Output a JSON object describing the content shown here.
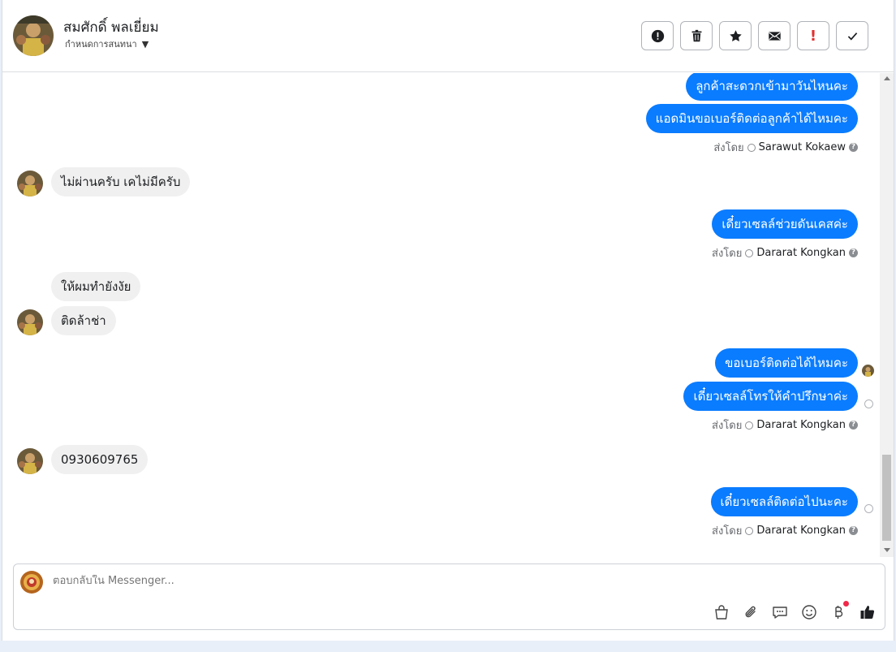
{
  "header": {
    "name": "สมศักดิ์ พลเยี่ยม",
    "subtitle": "กำหนดการสนทนา",
    "actions": [
      "important-icon",
      "trash-icon",
      "star-icon",
      "mail-icon",
      "exclamation-icon",
      "check-icon"
    ],
    "exclamation_glyph": "!"
  },
  "messages": {
    "m1": "ลูกค้าสะดวกเข้ามาวันไหนคะ",
    "m2": "แอดมินขอเบอร์ติดต่อลูกค้าได้ไหมคะ",
    "sent_label": "ส่งโดย",
    "sent1_who": "Sarawut Kokaew",
    "in1": "ไม่ผ่านครับ เคไม่มีครับ",
    "m3": "เดี๋ยวเซลล์ช่วยดันเคสค่ะ",
    "sent2_who": "Dararat Kongkan",
    "in2": "ให้ผมทำยังงัย",
    "in3": "ติดล้าช่า",
    "m4": "ขอเบอร์ติดต่อได้ไหมคะ",
    "m5": "เดี๋ยวเซลล์โทรให้คำปรึกษาค่ะ",
    "sent3_who": "Dararat Kongkan",
    "in4": "0930609765",
    "m6": "เดี๋ยวเซลล์ติดต่อไปนะคะ",
    "sent4_who": "Dararat Kongkan"
  },
  "composer": {
    "placeholder": "ตอบกลับใน Messenger...",
    "tools": [
      "shopping-bag-icon",
      "paperclip-icon",
      "saved-reply-icon",
      "emoji-icon",
      "baht-icon",
      "thumbs-up-icon"
    ]
  },
  "colors": {
    "outgoing": "#0a7cff",
    "incoming": "#f0f0f0",
    "like": "#1c1e21"
  }
}
